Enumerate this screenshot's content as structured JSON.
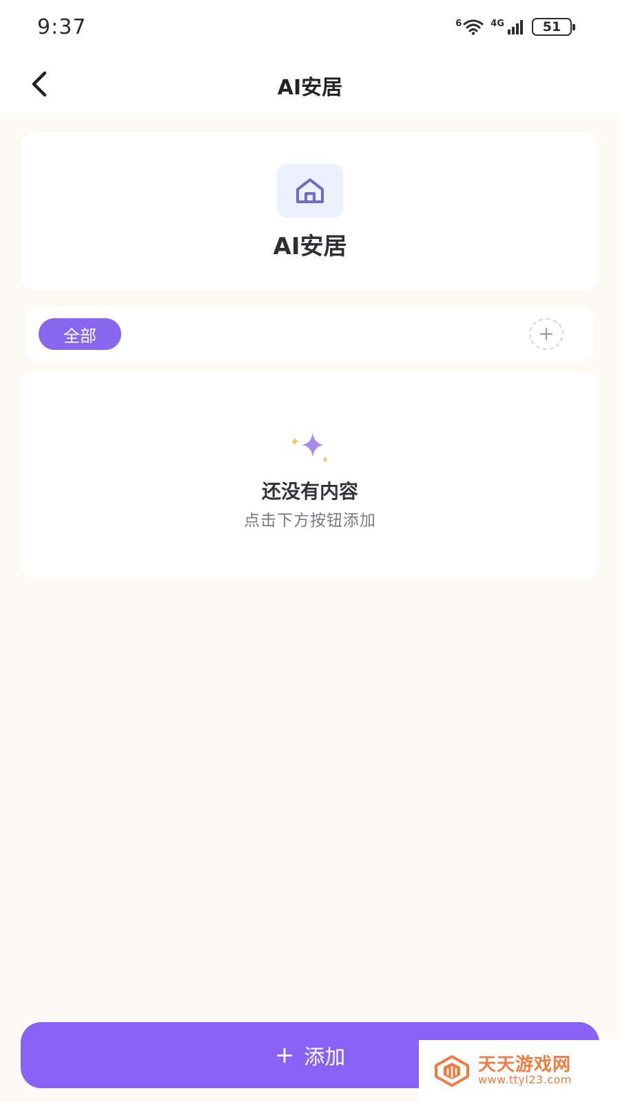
{
  "status_bar": {
    "time": "9:37",
    "wifi_label": "6",
    "network_label": "4G",
    "battery_level": "51"
  },
  "header": {
    "title": "AI安居"
  },
  "hero": {
    "icon": "home-icon",
    "title": "AI安居",
    "icon_bg_color": "#edf0fd",
    "icon_color": "#6f6cc9"
  },
  "categories": {
    "items": [
      {
        "label": "全部",
        "selected": true
      }
    ],
    "add_icon": "plus-icon"
  },
  "empty_state": {
    "icon": "sparkle-icon",
    "title": "还没有内容",
    "subtitle": "点击下方按钮添加"
  },
  "footer": {
    "add_icon": "+",
    "add_label": "添加"
  },
  "watermark": {
    "name": "天天游戏网",
    "url": "www.ttyl23.com"
  },
  "colors": {
    "accent": "#8862f4",
    "chip": "#8867ee",
    "background": "#fcfaf5",
    "watermark": "#f07b3f"
  }
}
